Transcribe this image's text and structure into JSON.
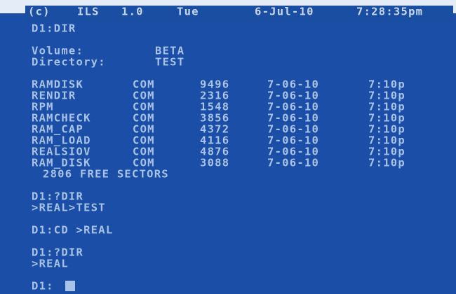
{
  "status_bar": {
    "copyright": "(c)",
    "product": "ILS",
    "version": "1.0",
    "day": "Tue",
    "date": "6-Jul-10",
    "time": "7:28:35pm"
  },
  "console": {
    "cmd1": "D1:DIR",
    "volume_label": "Volume:",
    "volume_value": "BETA",
    "directory_label": "Directory:",
    "directory_value": "TEST",
    "files": [
      {
        "name": "RAMDISK",
        "ext": "COM",
        "size": "9496",
        "date": "7-06-10",
        "time": "7:10p"
      },
      {
        "name": "RENDIR",
        "ext": "COM",
        "size": "2316",
        "date": "7-06-10",
        "time": "7:10p"
      },
      {
        "name": "RPM",
        "ext": "COM",
        "size": "1548",
        "date": "7-06-10",
        "time": "7:10p"
      },
      {
        "name": "RAMCHECK",
        "ext": "COM",
        "size": "3856",
        "date": "7-06-10",
        "time": "7:10p"
      },
      {
        "name": "RAM_CAP",
        "ext": "COM",
        "size": "4372",
        "date": "7-06-10",
        "time": "7:10p"
      },
      {
        "name": "RAM_LOAD",
        "ext": "COM",
        "size": "4116",
        "date": "7-06-10",
        "time": "7:10p"
      },
      {
        "name": "REALSIOV",
        "ext": "COM",
        "size": "4876",
        "date": "7-06-10",
        "time": "7:10p"
      },
      {
        "name": "RAM_DISK",
        "ext": "COM",
        "size": "3088",
        "date": "7-06-10",
        "time": "7:10p"
      }
    ],
    "free_sectors": "2806 FREE SECTORS",
    "cmd2": "D1:?DIR",
    "cmd2_output": ">REAL>TEST",
    "cmd3": "D1:CD >REAL",
    "cmd4": "D1:?DIR",
    "cmd4_output": ">REAL",
    "prompt": "D1:"
  },
  "colors": {
    "background": "#1b4ea6",
    "text": "#a9c3e8"
  }
}
